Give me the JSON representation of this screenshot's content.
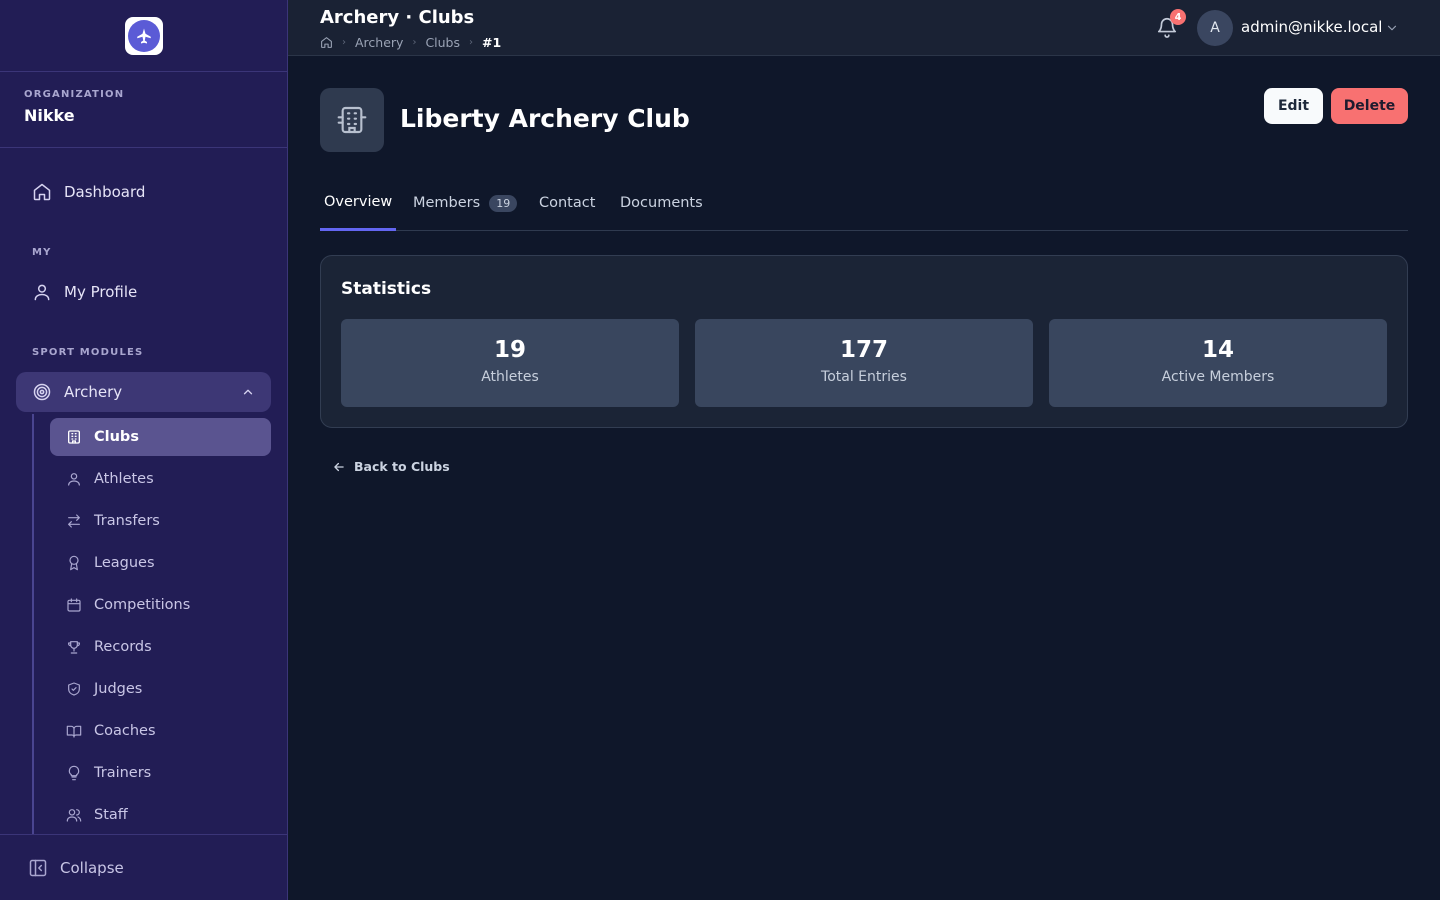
{
  "sidebar": {
    "org_label": "ORGANIZATION",
    "org_name": "Nikke",
    "dashboard": "Dashboard",
    "section_my": "MY",
    "my_profile": "My Profile",
    "section_sport": "SPORT MODULES",
    "archery": "Archery",
    "sub_items": [
      {
        "label": "Clubs",
        "icon": "building-icon"
      },
      {
        "label": "Athletes",
        "icon": "user-icon"
      },
      {
        "label": "Transfers",
        "icon": "arrows-icon"
      },
      {
        "label": "Leagues",
        "icon": "award-icon"
      },
      {
        "label": "Competitions",
        "icon": "calendar-icon"
      },
      {
        "label": "Records",
        "icon": "trophy-icon"
      },
      {
        "label": "Judges",
        "icon": "shield-icon"
      },
      {
        "label": "Coaches",
        "icon": "book-icon"
      },
      {
        "label": "Trainers",
        "icon": "lightbulb-icon"
      },
      {
        "label": "Staff",
        "icon": "users-icon"
      }
    ],
    "collapse": "Collapse"
  },
  "header": {
    "title": "Archery · Clubs",
    "breadcrumb": [
      "Archery",
      "Clubs",
      "#1"
    ],
    "notifications": "4",
    "avatar_initial": "A",
    "user_email": "admin@nikke.local"
  },
  "club": {
    "name": "Liberty Archery Club",
    "edit_label": "Edit",
    "delete_label": "Delete"
  },
  "tabs": [
    {
      "label": "Overview",
      "active": true
    },
    {
      "label": "Members",
      "count": "19"
    },
    {
      "label": "Contact"
    },
    {
      "label": "Documents"
    }
  ],
  "statistics": {
    "title": "Statistics",
    "items": [
      {
        "value": "19",
        "label": "Athletes"
      },
      {
        "value": "177",
        "label": "Total Entries"
      },
      {
        "value": "14",
        "label": "Active Members"
      }
    ]
  },
  "back_label": "Back to Clubs",
  "colors": {
    "sidebar_bg": "#221d55",
    "main_bg": "#0f172a",
    "accent": "#6366f1",
    "delete": "#f87171"
  }
}
